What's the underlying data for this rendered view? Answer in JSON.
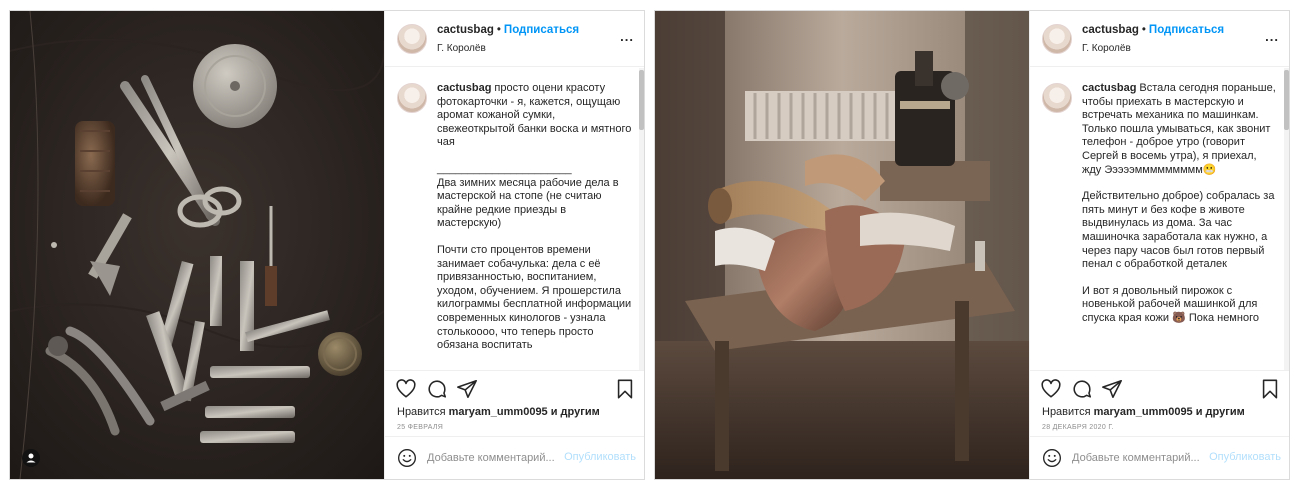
{
  "posts": [
    {
      "username": "cactusbag",
      "follow_label": "Подписаться",
      "separator": "•",
      "location": "Г. Королёв",
      "more_label": "...",
      "caption_user": "cactusbag",
      "caption_paragraphs": [
        "просто оцени красоту фотокарточки - я, кажется, ощущаю аромат кожаной сумки, свежеоткрытой банки воска и мятного чая",
        "______________________\nДва зимних месяца рабочие дела в мастерской на стопе (не считаю крайне редкие приезды в мастерскую)",
        "Почти сто процентов времени занимает собачулька: дела с её привязанностью, воспитанием, уходом, обучением. Я прошерстила килограммы бесплатной информации современных кинологов - узнала столькоооо, что теперь просто обязана воспитать"
      ],
      "likes_prefix": "Нравится ",
      "likes_user": "maryam_umm0095",
      "likes_suffix": " и другим",
      "date": "25 ФЕВРАЛЯ",
      "comment_placeholder": "Добавьте комментарий...",
      "publish_label": "Опубликовать",
      "icons": [
        "heart-icon",
        "comment-icon",
        "share-icon",
        "bookmark-icon",
        "emoji-icon",
        "user-tag-icon"
      ]
    },
    {
      "username": "cactusbag",
      "follow_label": "Подписаться",
      "separator": "•",
      "location": "Г. Королёв",
      "more_label": "...",
      "caption_user": "cactusbag",
      "caption_paragraphs": [
        "Встала сегодня пораньше, чтобы приехать в мастерскую и встречать механика по машинкам. Только пошла умываться, как звонит телефон - доброе утро (говорит Сергей в восемь утра), я приехал, жду Эээээммммммммм😬",
        "Действительно доброе) собралась за пять минут и без кофе в животе выдвинулась из дома. За час машиночка заработала как нужно, а через пару часов был готов первый пенал с обработкой деталек",
        "И вот я довольный пирожок с новенькой рабочей машинкой для спуска края кожи 🐻 Пока немного"
      ],
      "likes_prefix": "Нравится ",
      "likes_user": "maryam_umm0095",
      "likes_suffix": " и другим",
      "date": "28 ДЕКАБРЯ 2020 Г.",
      "comment_placeholder": "Добавьте комментарий...",
      "publish_label": "Опубликовать",
      "icons": [
        "heart-icon",
        "comment-icon",
        "share-icon",
        "bookmark-icon",
        "emoji-icon"
      ]
    }
  ],
  "colors": {
    "follow": "#0095f6",
    "publish_disabled": "#b2dffc",
    "border": "#dbdbdb",
    "text": "#262626",
    "muted": "#8e8e8e"
  }
}
